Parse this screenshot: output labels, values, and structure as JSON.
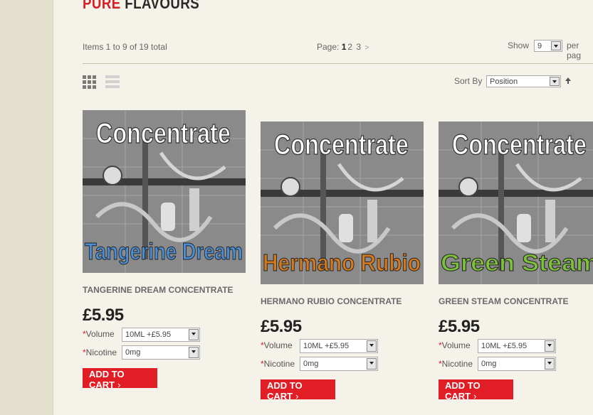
{
  "page": {
    "title_red": "PURE",
    "title_dark": "FLAVOURS"
  },
  "toolbar": {
    "items_count": "Items 1 to 9 of 19 total",
    "page_label": "Page:",
    "pages": [
      "1",
      "2",
      "3"
    ],
    "next_arrow": ">",
    "show_label": "Show",
    "show_value": "9",
    "per_page_label": "per pag",
    "sort_label": "Sort By",
    "sort_value": "Position"
  },
  "products": [
    {
      "name": "TANGERINE DREAM CONCENTRATE",
      "image_title": "Concentrate",
      "image_subtitle": "Tangerine Dream",
      "subtitle_color": "#4a8fd6",
      "price": "£5.95",
      "volume_label": "Volume",
      "volume_value": "10ML +£5.95",
      "nicotine_label": "Nicotine",
      "nicotine_value": "0mg",
      "cart_label": "ADD TO CART",
      "cart_chevron": "›"
    },
    {
      "name": "HERMANO RUBIO CONCENTRATE",
      "image_title": "Concentrate",
      "image_subtitle": "Hermano Rubio",
      "subtitle_color": "#d57a1c",
      "price": "£5.95",
      "volume_label": "Volume",
      "volume_value": "10ML +£5.95",
      "nicotine_label": "Nicotine",
      "nicotine_value": "0mg",
      "cart_label": "ADD TO CART",
      "cart_chevron": "›"
    },
    {
      "name": "GREEN STEAM CONCENTRATE",
      "image_title": "Concentrate",
      "image_subtitle": "Green Steam",
      "subtitle_color": "#7dc03a",
      "price": "£5.95",
      "volume_label": "Volume",
      "volume_value": "10ML +£5.95",
      "nicotine_label": "Nicotine",
      "nicotine_value": "0mg",
      "cart_label": "ADD TO CART",
      "cart_chevron": "›"
    }
  ],
  "colors": {
    "accent_red": "#e11d26",
    "background": "#f5f2ea",
    "sidebar": "#e3e0ce"
  }
}
